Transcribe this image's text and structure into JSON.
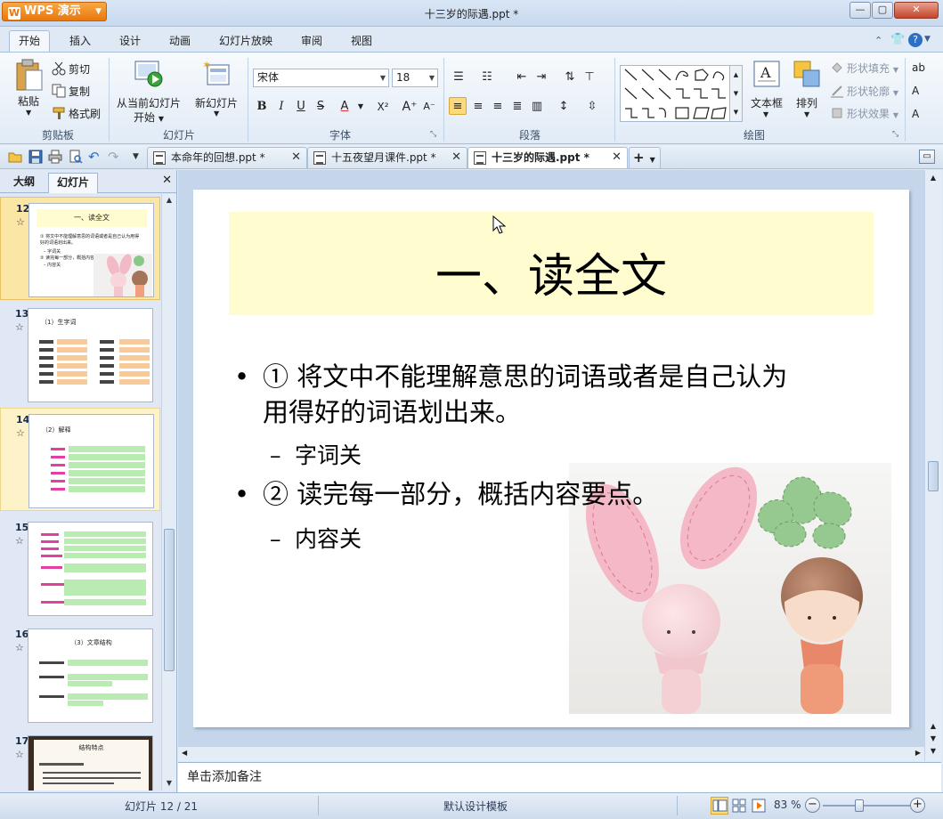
{
  "app": {
    "button_label": "WPS 演示",
    "window_title": "十三岁的际遇.ppt *"
  },
  "ribbon_tabs": [
    "开始",
    "插入",
    "设计",
    "动画",
    "幻灯片放映",
    "审阅",
    "视图"
  ],
  "clipboard": {
    "paste": "粘贴",
    "cut": "剪切",
    "copy": "复制",
    "format_painter": "格式刷",
    "group": "剪贴板"
  },
  "slides_group": {
    "from_current": "从当前幻灯片",
    "from_current_2": "开始",
    "new_slide": "新幻灯片",
    "group": "幻灯片"
  },
  "font": {
    "name": "宋体",
    "size": "18",
    "group": "字体",
    "bold": "B",
    "italic": "I",
    "underline": "U",
    "shadow": "S",
    "color": "A"
  },
  "paragraph": {
    "group": "段落"
  },
  "drawing": {
    "textbox": "文本框",
    "arrange": "排列",
    "fill": "形状填充",
    "outline": "形状轮廓",
    "effect": "形状效果",
    "group": "绘图"
  },
  "doc_tabs": [
    {
      "title": "本命年的回想.ppt *"
    },
    {
      "title": "十五夜望月课件.ppt *"
    },
    {
      "title": "十三岁的际遇.ppt *"
    }
  ],
  "left_panel": {
    "tab_outline": "大纲",
    "tab_slides": "幻灯片"
  },
  "thumbnails": [
    {
      "num": "12",
      "title": "一、读全文",
      "lines": [
        "① 将文中不能理解意思的词语或者是自己认为用得好的词语划出来。",
        "– 字词关",
        "② 读完每一部分，概括内容要点。",
        "– 内容关"
      ]
    },
    {
      "num": "13",
      "title": "（1）生字词"
    },
    {
      "num": "14",
      "title": "（2）解释"
    },
    {
      "num": "15"
    },
    {
      "num": "16",
      "title": "（3）文章结构"
    },
    {
      "num": "17",
      "title": "结构特点"
    }
  ],
  "slide": {
    "title": "一、读全文",
    "bullets": [
      {
        "level": 1,
        "marker": "•",
        "text": "① 将文中不能理解意思的词语或者是自己认为",
        "text2": "用得好的词语划出来。"
      },
      {
        "level": 2,
        "marker": "–",
        "text": "字词关"
      },
      {
        "level": 1,
        "marker": "•",
        "text": "② 读完每一部分，概括内容要点。"
      },
      {
        "level": 2,
        "marker": "–",
        "text": "内容关"
      }
    ]
  },
  "notes_placeholder": "单击添加备注",
  "status": {
    "slide_info": "幻灯片 12 / 21",
    "template": "默认设计模板",
    "zoom": "83 %",
    "zoom_value": 83
  },
  "colors": {
    "title_box": "#fffccf",
    "accent": "#e9770e",
    "selected_thumb": "#fbe6a5"
  }
}
